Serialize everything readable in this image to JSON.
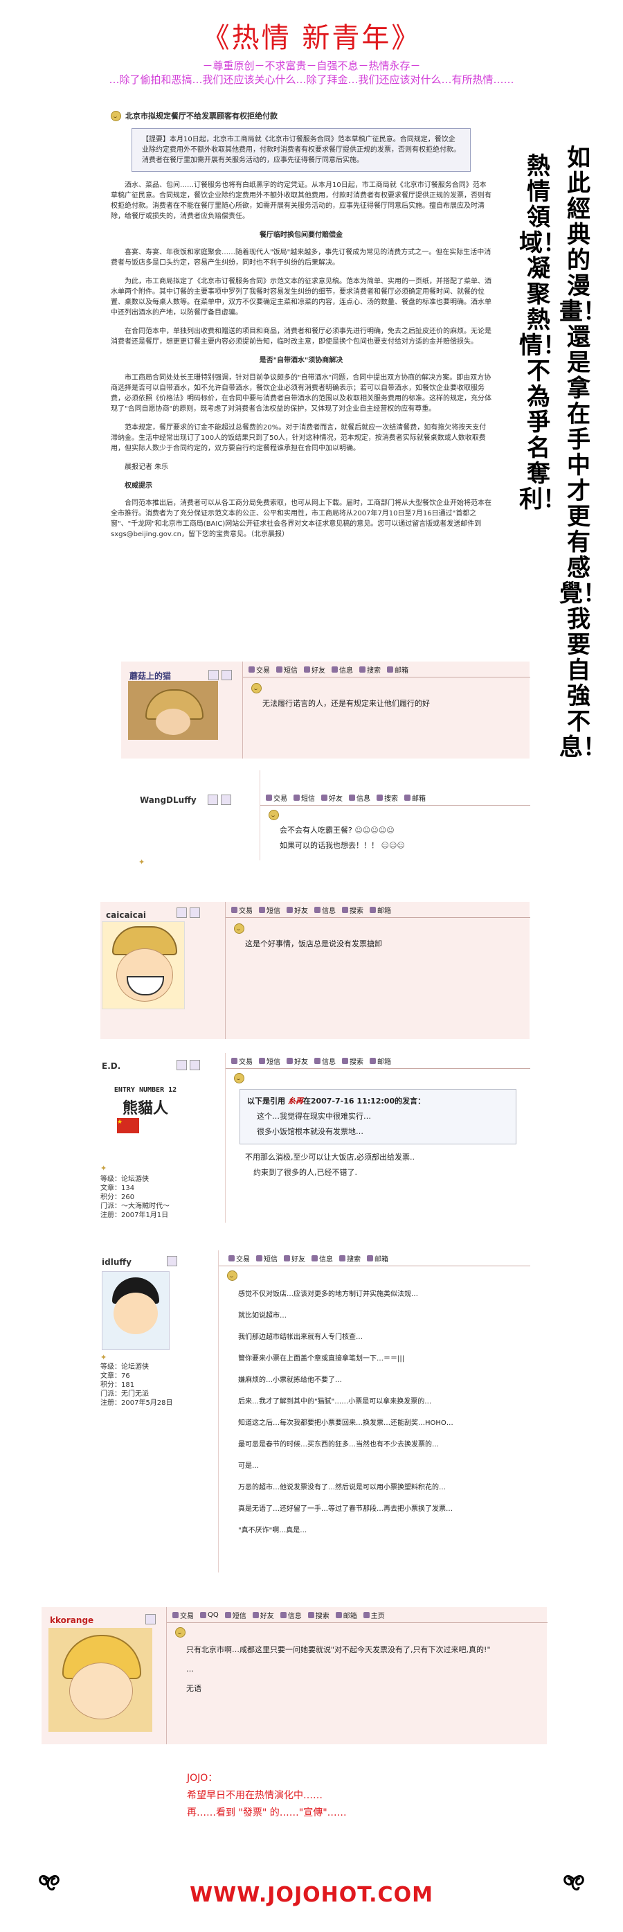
{
  "header": {
    "title": "《热情  新青年》",
    "line1": "－尊重原创－不求富贵－自强不息－热情永存－",
    "line2": "…除了偷拍和恶搞…我们还应该关心什么…除了拜金…我们还应该对什么…有所热情……"
  },
  "article": {
    "headline": "北京市拟规定餐厅不给发票顾客有权拒绝付款",
    "summary": "【提要】本月10日起，北京市工商局就《北京市订餐服务合同》范本草稿广征民意。合同规定，餐饮企业除约定费用外不额外收取其他费用，付款时消费者有权要求餐厅提供正规的发票，否则有权拒绝付款。消费者在餐厅里加需开展有关服务活动的，应事先征得餐厅同意后实施。",
    "p1": "酒水、菜品、包间……订餐服务也将有白纸黑字的约定凭证。从本月10日起，市工商局就《北京市订餐服务合同》范本草稿广征民意。合同规定，餐饮企业除约定费用外不额外收取其他费用，付款时消费者有权要求餐厅提供正规的发票，否则有权拒绝付款。消费者在不能在餐厅里随心所欲，如需开展有关服务活动的，应事先征得餐厅同意后实施。擅自布展应及时清除，给餐厅或损失的，消费者应负赔偿责任。",
    "h1": "餐厅临时换包间要付赔偿金",
    "p2": "喜宴、寿宴、年夜饭和家庭聚会……随着现代人\"饭局\"越来越多，事先订餐成为常见的消费方式之一。但在实际生活中消费者与饭店多是口头约定，容易产生纠纷，同时也不利于纠纷的后果解决。",
    "p3": "为此，市工商局拟定了《北京市订餐服务合同》示范文本的征求意见稿。范本为简单、实用的一页纸，并搭配了菜单、酒水单两个附件。其中订餐的主要事项中罗列了我餐时容易发生纠纷的细节，要求消费者和餐厅必须确定用餐时间、就餐的位置、桌数以及每桌人数等。在菜单中，双方不仅要确定主菜和凉菜的内容，连点心、汤的数量、餐盘的标准也要明确。酒水单中还列出酒水的产地，以防餐厅备目虚骗。",
    "p4": "在合同范本中，单独列出收费和赠送的项目和商品，消费者和餐厅必须事先进行明确，免去之后扯皮还价的麻烦。无论是消费者还是餐厅，想更更订餐主要内容必须提前告知，临时改主意，即使是换个包间也要支付给对方适的金并赔偿损失。",
    "h2": "是否\"自带酒水\"须协商解决",
    "p5": "市工商局合同处处长王珊特别强调，针对目前争议颇多的\"自带酒水\"问题，合同中提出双方协商的解决方案。即由双方协商选择是否可以自带酒水，如不允许自带酒水，餐饮企业必须有消费者明确表示；若可以自带酒水，如餐饮企业要收取服务费，必须依照《价格法》明码标价，在合同中要与消费者自带酒水的范围以及收取相关服务费用的标准。这样的规定，充分体现了\"合同自愿协商\"的原则，既考虑了对消费者合法权益的保护，又体现了对企业自主经营权的应有尊重。",
    "p6": "范本规定，餐厅要求的订金不能超过总餐费的20%。对于消费者而言，就餐后就应一次结清餐费，如有拖欠将按天支付滞纳金。生活中经常出现订了100人的饭结果只到了50人，针对这种情况，范本规定，按消费者实际就餐桌数或人数收取费用，但实际人数少于合同约定的，双方要自行约定餐程谁承担在合同中加以明确。",
    "reporter": "晨报记者 朱乐",
    "h3": "权威提示",
    "p7": "合同范本推出后，消费者可以从各工商分局免费索取，也可从网上下载。届时，工商部门将从大型餐饮企业开始将范本在全市推行。消费者为了充分保证示范文本的公正、公平和实用性，市工商局将从2007年7月10日至7月16日通过\"首都之窗\"、\"千龙网\"和北京市工商局(BAIC)网站公开征求社会各界对文本征求意见稿的意见。您可以通过留言版或者发送邮件到sxgs@beijing.gov.cn，留下您的宝贵意见。（北京晨报）"
  },
  "vertical_text": {
    "col1": "如此經典的漫畫！還是拿在手中才更有感覺！我要自強不息！",
    "col2": "熱情領域！凝聚熱情！不為爭名奪利！"
  },
  "toolbar": {
    "trade": "交易",
    "message": "短信",
    "friend": "好友",
    "info": "信息",
    "search": "搜索",
    "mail": "邮箱",
    "qq": "QQ",
    "homepage": "主页"
  },
  "posts": [
    {
      "username": "蘑菇上的猫",
      "lines": [
        "无法履行诺言的人，还是有规定来让他们履行的好"
      ]
    },
    {
      "username": "WangDLuffy",
      "lines": [
        "会不会有人吃霸王餐?",
        "如果可以的话我也想去！！！"
      ]
    },
    {
      "username": "caicaicai",
      "lines": [
        "这是个好事情，饭店总是说没有发票搪卸"
      ]
    },
    {
      "username": "E.D.",
      "avatar_lines": [
        "ENTRY NUMBER 12",
        "熊貓人"
      ],
      "info": [
        "等级：论坛游侠",
        "文章：134",
        "积分：260",
        "门派：～大海贼时代～",
        "注册：2007年1月1日"
      ],
      "quote_header": "以下是引用 ",
      "quote_user": "糸再",
      "quote_mid": "在2007-7-16 11:12:00的发言：",
      "quote_lines": [
        "这个…我觉得在现实中很难实行…",
        "很多小饭馆根本就没有发票地…"
      ],
      "lines": [
        "不用那么消极,至少可以让大饭店,必须部出给发票..",
        "约束到了很多的人,已经不错了."
      ]
    },
    {
      "username": "idluffy",
      "info": [
        "等级：论坛游侠",
        "文章：76",
        "积分：181",
        "门派：无门无派",
        "注册：2007年5月28日"
      ],
      "lines": [
        "感觉不仅对饭店…应该对更多的地方制订并实施类似法规…",
        "就比如说超市…",
        "我们那边超市结帐出来就有人专门核查…",
        "管你要来小票在上面盖个章或直接拿笔划一下…＝＝|||",
        "嫌麻烦的…小票就拣给他不要了…",
        "后来…我才了解到其中的\"猫腻\"……小票是可以拿来换发票的…",
        "知道这之后…每次我都要把小票要回来…换发票…还能刮奖…HOHO…",
        "最可恶是春节的时候…买东西的狂多…当然也有不少去换发票的…",
        "可是…",
        "万恶的超市…他说发票没有了…然后说是可以用小票换塑料积花的…",
        "真是无语了…还好留了一手…等过了春节那段…再去把小票换了发票…",
        "\"真不厌诈\"啊…真是…"
      ]
    },
    {
      "username": "kkorange",
      "lines": [
        "只有北京市啊…咸都这里只要一问她要就说\"对不起今天发票没有了,只有下次过来吧,真的!\"",
        "…",
        "无语"
      ]
    }
  ],
  "footer": {
    "line1": "JOJO：",
    "line2": "希望早日不用在热情演化中……",
    "line3": "再……看到 \"發票\" 的……\"宣傳\"……",
    "site": "WWW.JOJOHOT.COM"
  }
}
